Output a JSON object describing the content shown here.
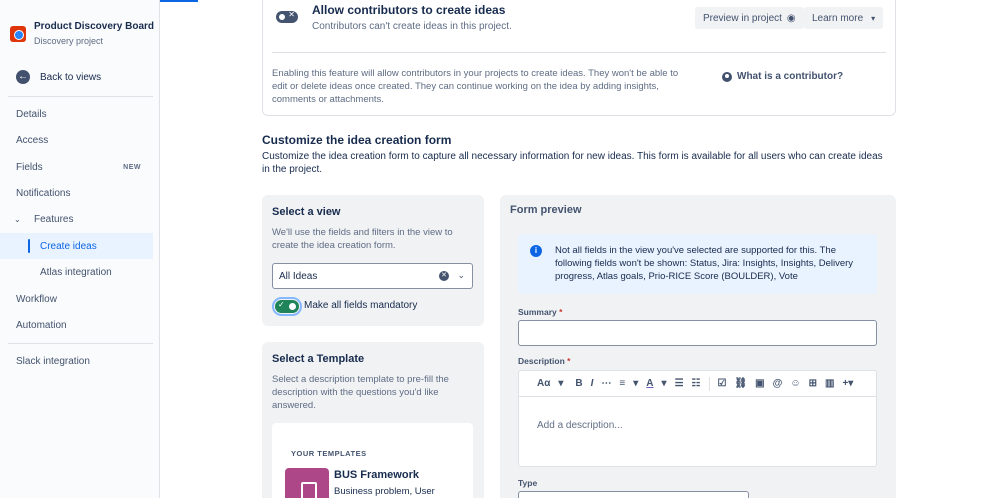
{
  "project": {
    "title": "Product Discovery Board",
    "subtitle": "Discovery project"
  },
  "sidebar": {
    "back_label": "Back to views",
    "items": [
      {
        "label": "Details"
      },
      {
        "label": "Access"
      },
      {
        "label": "Fields",
        "badge": "NEW"
      },
      {
        "label": "Notifications"
      },
      {
        "label": "Features"
      },
      {
        "label": "Create ideas"
      },
      {
        "label": "Atlas integration"
      },
      {
        "label": "Workflow"
      },
      {
        "label": "Automation"
      },
      {
        "label": "Slack integration"
      }
    ]
  },
  "allow_card": {
    "title": "Allow contributors to create ideas",
    "subtitle": "Contributors can't create ideas in this project.",
    "preview_label": "Preview in project",
    "learn_more_label": "Learn more",
    "enable_text": "Enabling this feature will allow contributors in your projects to create ideas. They won't be able to edit or delete ideas once created. They can continue working on the idea by adding insights, comments or attachments.",
    "contributor_link": "What is a contributor?"
  },
  "customize": {
    "title": "Customize the idea creation form",
    "description": "Customize the idea creation form to capture all necessary information for new ideas. This form is available for all users who can create ideas in the project."
  },
  "select_view": {
    "title": "Select a view",
    "description": "We'll use the fields and filters in the view to create the idea creation form.",
    "selected_value": "All Ideas",
    "mandatory_label": "Make all fields mandatory"
  },
  "select_template": {
    "title": "Select a Template",
    "description": "Select a description template to pre-fill the description with the questions you'd like answered.",
    "templates_heading": "YOUR TEMPLATES",
    "template_name": "BUS Framework",
    "template_desc": "Business problem, User"
  },
  "form_preview": {
    "title": "Form preview",
    "info_text": "Not all fields in the view you've selected are supported for this. The following fields won't be shown: Status, Jira: Insights, Insights, Delivery progress, Atlas goals, Prio-RICE Score (BOULDER), Vote",
    "summary_label": "Summary",
    "description_label": "Description",
    "description_placeholder": "Add a description...",
    "type_label": "Type",
    "required_marker": "*",
    "toolbar": {
      "text_style": "Aα",
      "bold": "B",
      "italic": "I",
      "align": "≡",
      "color": "A"
    }
  }
}
